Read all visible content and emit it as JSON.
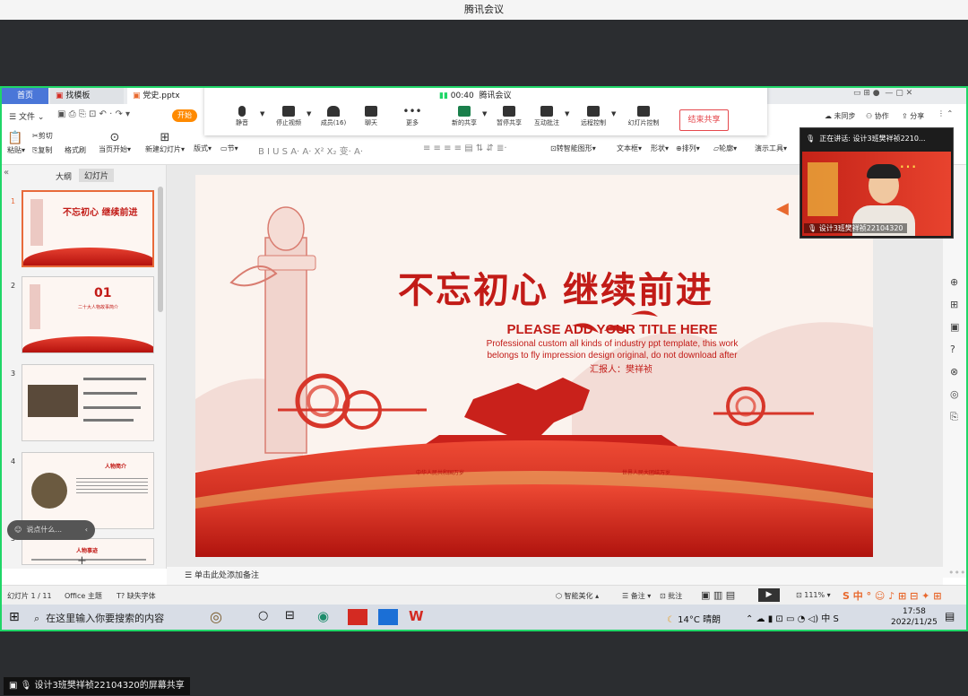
{
  "window": {
    "title": "腾讯会议"
  },
  "wps_tabs": [
    {
      "label": "首页"
    },
    {
      "label": "找模板"
    },
    {
      "label": "党史.pptx"
    }
  ],
  "meeting_toolbar": {
    "timer": "00:40",
    "app_name": "腾讯会议",
    "buttons": [
      {
        "label": "静音",
        "icon": "mic-icon"
      },
      {
        "label": "停止视频",
        "icon": "camera-icon"
      },
      {
        "label": "成员(16)",
        "icon": "members-icon"
      },
      {
        "label": "聊天",
        "icon": "chat-icon"
      },
      {
        "label": "更多",
        "icon": "more-icon"
      },
      {
        "label": "新的共享",
        "icon": "new-share-icon"
      },
      {
        "label": "暂停共享",
        "icon": "pause-share-icon"
      },
      {
        "label": "互动批注",
        "icon": "annotate-icon"
      },
      {
        "label": "远程控制",
        "icon": "remote-control-icon"
      },
      {
        "label": "幻灯片控制",
        "icon": "slide-control-icon"
      }
    ],
    "end_share": "结束共享"
  },
  "ribbon": {
    "file_menu": "文件",
    "start_button": "开始",
    "row1_right": [
      "未同步",
      "协作",
      "分享"
    ],
    "row2": [
      "粘贴",
      "复制",
      "格式刷",
      "当页开始",
      "新建幻灯片",
      "版式",
      "节",
      "文本框",
      "形状",
      "排列",
      "轮廓",
      "演示工具"
    ],
    "cut": "剪切",
    "convert_smart": "转智能图形"
  },
  "slide_panel": {
    "tab_outline": "大纲",
    "tab_slides": "幻灯片",
    "thumb_numbers": [
      "1",
      "2",
      "3",
      "4",
      "5"
    ],
    "thumb2_big": "01",
    "thumb2_sub": "二十大人物故事简介",
    "thumb4_title": "人物简介",
    "thumb5_title": "人物事迹"
  },
  "slide": {
    "calligraphy": "不忘初心 继续前进",
    "title": "PLEASE ADD YOUR TITLE HERE",
    "subtitle_line1": "Professional custom all kinds of industry ppt template, this work",
    "subtitle_line2": "belongs to fly impression design original, do not download after",
    "reporter": "汇报人：樊祥祯",
    "banner_left": "中华人民共和国万岁",
    "banner_right": "世界人民大团结万岁"
  },
  "chat_input": {
    "placeholder": "说点什么..."
  },
  "notes_placeholder": "单击此处添加备注",
  "status_bar": {
    "slide_count": "幻灯片 1 / 11",
    "theme": "Office 主题",
    "missing_font": "缺失字体",
    "smart_beautify": "智能美化",
    "notes": "备注",
    "annotate": "批注",
    "zoom": "111%"
  },
  "taskbar": {
    "search_placeholder": "在这里输入你要搜索的内容",
    "weather_temp": "14°C",
    "weather_desc": "晴朗",
    "ime": "中",
    "time": "17:58",
    "date": "2022/11/25"
  },
  "video_tile": {
    "speaking": "正在讲话: 设计3班樊祥祯2210...",
    "name": "设计3班樊祥祯22104320"
  },
  "screen_share_label": "设计3班樊祥祯22104320的屏幕共享",
  "colors": {
    "share_border": "#1fd667",
    "accent_red": "#d42a22",
    "wps_blue": "#4a76d8",
    "start_orange": "#ff8a00"
  }
}
